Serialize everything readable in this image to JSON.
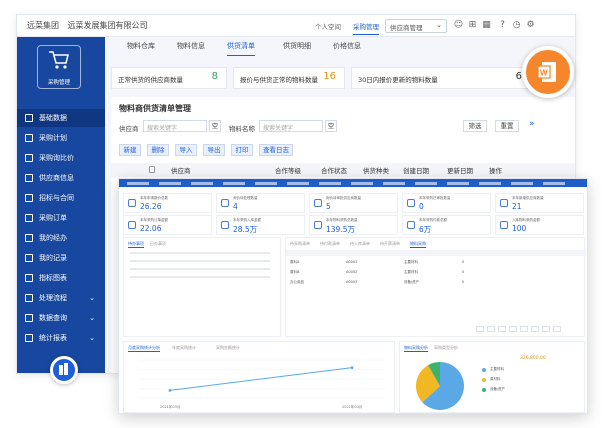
{
  "topbar": {
    "org": "远菜集团",
    "org_full": "远菜发展集团有限公司",
    "nav": [
      "个人空间",
      "采购管理"
    ],
    "select": "供应商管理"
  },
  "sidebar": {
    "logo_text": "采购管理",
    "items": [
      {
        "label": "基础数据",
        "expandable": false
      },
      {
        "label": "采购计划",
        "expandable": false
      },
      {
        "label": "采购询比价",
        "expandable": false
      },
      {
        "label": "供应商信息",
        "expandable": false
      },
      {
        "label": "招标与合同",
        "expandable": false
      },
      {
        "label": "采购订单",
        "expandable": false
      },
      {
        "label": "我的经办",
        "expandable": false
      },
      {
        "label": "我的记录",
        "expandable": false
      },
      {
        "label": "指标图表",
        "expandable": false
      },
      {
        "label": "处理流程",
        "expandable": true
      },
      {
        "label": "数据查询",
        "expandable": true
      },
      {
        "label": "统计报表",
        "expandable": true
      }
    ]
  },
  "tabs": [
    "物料仓库",
    "物料信息",
    "供货清单",
    "供货明细",
    "价格信息"
  ],
  "stats": [
    {
      "label": "正常供货的供应商数量",
      "value": "8",
      "color": "#3aa55c"
    },
    {
      "label": "报价与供货正常的物料数量",
      "value": "16",
      "color": "#e0911a"
    },
    {
      "label": "30日内报价更新的物料数量",
      "value": "6",
      "color": "#333333"
    }
  ],
  "panel": {
    "title": "物料商供货清单管理",
    "filters": {
      "supplier_label": "供应商",
      "supplier_placeholder": "搜索关键字",
      "material_label": "物料名称",
      "material_placeholder": "搜索关键字",
      "empty_btn": "空"
    },
    "filter_btn": "筛选",
    "reset_btn": "重置",
    "toolbar": [
      "新建",
      "删除",
      "导入",
      "导出",
      "打印",
      "查看日志"
    ],
    "columns": [
      "供应商",
      "合作等级",
      "合作状态",
      "供货种类",
      "创建日期",
      "更新日期",
      "操作"
    ]
  },
  "dashboard": {
    "cards_row1": [
      {
        "label": "本年申请报价总数",
        "value": "26.26"
      },
      {
        "label": "询价待处理数量",
        "value": "4"
      },
      {
        "label": "询价待审批供应商数量",
        "value": "5"
      },
      {
        "label": "本年采购已审批数量",
        "value": "0"
      },
      {
        "label": "本年新增供应商数量",
        "value": "21"
      }
    ],
    "cards_row2": [
      {
        "label": "本年采购订单金额",
        "value": "22.06"
      },
      {
        "label": "本年采购入库金额",
        "value": "28.5万"
      },
      {
        "label": "本年物料采购总数量",
        "value": "139.5万"
      },
      {
        "label": "本年采购付款总额",
        "value": "6万"
      },
      {
        "label": "入库物料采购金额",
        "value": "100"
      }
    ],
    "mid_left_tabs": [
      "待办事项",
      "已办事项"
    ],
    "mid_right_tabs": [
      "待采购清单",
      "待付款清单",
      "待入库清单",
      "待开票清单",
      "物料采购"
    ],
    "mid_right_rows": [
      {
        "name": "原料A",
        "code": "A0001",
        "unit": "主要材料",
        "qty": "0"
      },
      {
        "name": "原料B",
        "code": "A0002",
        "unit": "主要材料",
        "qty": "0"
      },
      {
        "name": "办公用品",
        "code": "A0003",
        "unit": "设备/资产",
        "qty": "0"
      }
    ],
    "bottom_left_tabs": [
      "月度采购统计分析",
      "年度采购统计",
      "采购金额统计"
    ],
    "bottom_right_tabs": [
      "物料采购分析",
      "采购类型分析"
    ],
    "bottom_right_total": "326,800.00",
    "bottom_right_legend": [
      "主要材料",
      "原材料",
      "设备/资产"
    ],
    "bottom_left_x": [
      "2021年03月",
      "2021年04月"
    ],
    "line_points": [
      {
        "x": "2021年03月",
        "y": 1
      },
      {
        "x": "2021年04月",
        "y": 4
      }
    ],
    "pie": [
      {
        "name": "主要材料",
        "value": 63.2,
        "color": "#5aa9e6"
      },
      {
        "name": "原材料",
        "value": 28.5,
        "color": "#f0b823"
      },
      {
        "name": "设备/资产",
        "value": 8.3,
        "color": "#3db26a"
      }
    ]
  }
}
